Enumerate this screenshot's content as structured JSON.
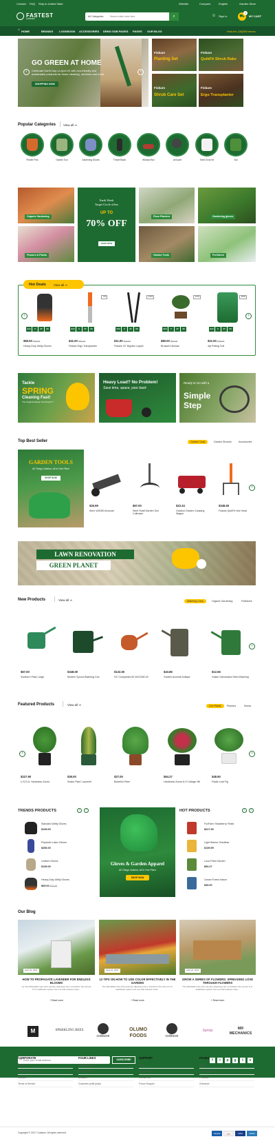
{
  "topbar": {
    "contact": "Contact",
    "faq": "FAQ",
    "ship": "Ship to United State",
    "wishlist": "Wishlist",
    "compare": "Compare",
    "language": "English",
    "store": "Garden Store"
  },
  "header": {
    "logo": "FASTEST",
    "logo_sub": "GARDEN",
    "category_select": "All Categories",
    "search_placeholder": "Search entire store here",
    "signin": "Sign In",
    "cart_count": "0",
    "cart_label": "MY CART"
  },
  "nav": {
    "items": [
      "HOME",
      "BRANDS",
      "LOOKBOOK",
      "ACCESSORIES",
      "DEMO SUB PAGES",
      "PAGES",
      "OUR BLOG"
    ],
    "hotline": "HotLine: (36)359 shoes"
  },
  "hero": {
    "title": "GO GREEN AT HOME",
    "text": "Celebrate Earth Day on April 22 with eco-friendly and sustainable products for home cleaning, outdoors and more.",
    "button": "SHOPPING NOW"
  },
  "hero_tiles": [
    {
      "brand": "Fiskars",
      "label": "Planting Set"
    },
    {
      "brand": "Fiskars",
      "label": "QuikFit Shrub Rake"
    },
    {
      "brand": "Fiskars",
      "label": "Shrub Care Set"
    },
    {
      "brand": "Fiskars",
      "label": "Ergo Transplanter"
    }
  ],
  "popular": {
    "title": "Popular Categories",
    "view_all": "View all",
    "items": [
      "Planter Pots",
      "Garden Tool",
      "Gardening Gloves",
      "Trowel Black",
      "Window Box",
      "Aerocart",
      "Seed Grow Kit",
      "Soil"
    ]
  },
  "promo": {
    "tiles": [
      "Organic Gardening",
      "Flowers & Plants",
      "Floor Planters",
      "Gardening gloves",
      "Garden Tools",
      "Fertilizers"
    ],
    "center_line1": "Earth Week",
    "center_line2": "Target Circle offers",
    "center_upto": "UP TO",
    "center_off": "70% OFF",
    "center_btn": "SHOP NOW"
  },
  "hot_deals": {
    "title": "Hot Deals",
    "view_all": "View all",
    "countdown": {
      "labels": [
        "Days",
        "Hours",
        "Mins",
        "Secs"
      ]
    },
    "items": [
      {
        "price": "$65.00",
        "old": "$75.00",
        "name": "Heavy-Duty Utility Gloves",
        "cd": [
          "910",
          "5",
          "37",
          "20"
        ]
      },
      {
        "price": "$41.00",
        "old": "$50.00",
        "name": "Fiskars Ergo Transplanter",
        "cd": [
          "910",
          "5",
          "37",
          "20"
        ],
        "badge": "-7%"
      },
      {
        "price": "$11.00",
        "old": "$19.00",
        "name": "Fiskars 24\" Bypass Lopper",
        "cd": [
          "240",
          "5",
          "37",
          "20"
        ],
        "badge": "-12%"
      },
      {
        "price": "$80.00",
        "old": "$92.00",
        "name": "Brussel's Bonsai",
        "cd": [
          "912",
          "5",
          "37",
          "20"
        ],
        "badge": "-12%"
      },
      {
        "price": "$21.00",
        "old": "$29.00",
        "name": "4qt Potting Soil",
        "cd": [
          "910",
          "5",
          "37",
          "20"
        ],
        "badge": "-20%"
      }
    ]
  },
  "banners3": [
    {
      "line1": "Tackle",
      "line2": "SPRING",
      "line3": "Cleaning Fast!",
      "line4": "The Original Garden Tool Scoop™"
    },
    {
      "line1": "Heavy Load? No Problem!",
      "line2": "Save time, space, your back"
    },
    {
      "line1": "Ready to Go with a",
      "line2": "Simple",
      "line3": "Step"
    }
  ],
  "best_seller": {
    "title": "Top Best Seller",
    "tabs": [
      "Garden Tools",
      "Garden Shovels",
      "Accessories"
    ],
    "banner_title": "GARDEN TOOLS",
    "banner_sub": "All Things Outdoor, All In One Place",
    "banner_btn": "SHOP NOW",
    "items": [
      {
        "price": "$25.99",
        "name": "Worx WG050 Aerocart"
      },
      {
        "price": "$67.00",
        "name": "Steel Shaft Garden Soil Cultivator"
      },
      {
        "price": "$23.34",
        "name": "Outdoor Garden Camping Wagon"
      },
      {
        "price": "$348.50",
        "name": "Fiskars QuikFit Hoe Head"
      }
    ]
  },
  "lawn": {
    "line1": "LAWN RENOVATION",
    "line2": "GREEN PLANET"
  },
  "new_products": {
    "title": "New Products",
    "view_all": "View all",
    "tabs": [
      "Watering Cans",
      "Organic Gardening",
      "Fertilizers"
    ],
    "items": [
      {
        "price": "$67.00",
        "name": "Southern Patio Large"
      },
      {
        "price": "$348.00",
        "name": "Modern Sprout Watering Can"
      },
      {
        "price": "$132.00",
        "name": "HC Companies 82 WC2G8C20"
      },
      {
        "price": "$43.86",
        "name": "Garden Accents Antique"
      },
      {
        "price": "$12.56",
        "name": "Gallon Galvanized Steel Watering"
      }
    ]
  },
  "featured": {
    "title": "Featured Products",
    "view_all": "View all",
    "tabs": [
      "Live Plants",
      "Planters",
      "Seeds"
    ],
    "items": [
      {
        "price": "$227.90",
        "name": "U.S.D.A. Hardiness Zones"
      },
      {
        "price": "$35.00",
        "name": "Snake Plant 'Laurentii'"
      },
      {
        "price": "$27.00",
        "name": "Bobellini Palm"
      },
      {
        "price": "$64.27",
        "name": "Hardiness Zones 6-9 Cottage Hill"
      },
      {
        "price": "$48.90",
        "name": "Fiddle Leaf Fig"
      }
    ]
  },
  "trends": {
    "title": "TRENDS PRODUCTS",
    "items": [
      {
        "name": "Standard Utility Gloves",
        "price": "$139.00"
      },
      {
        "name": "Polyester Latex Gloves",
        "price": "$256.00"
      },
      {
        "name": "Leather Gloves",
        "price": "$139.00"
      },
      {
        "name": "Heavy-Duty Utility Gloves",
        "price": "$65.00",
        "old": "$77.00"
      }
    ]
  },
  "gloves_banner": {
    "title": "Gloves & Garden Apparel",
    "sub": "All Things Outdoor, All In One Place",
    "btn": "SHOP NOW"
  },
  "hot_products": {
    "title": "HOT PRODUCTS",
    "items": [
      {
        "name": "FoxFarm Strawberry Fields",
        "price": "$227.90"
      },
      {
        "name": "Light Warrior Seedless",
        "price": "$139.99"
      },
      {
        "name": "Lucci Plant Garden",
        "price": "$54.27"
      },
      {
        "name": "Ocean Forest Indoor",
        "price": "$35.00"
      }
    ]
  },
  "blog": {
    "title": "Our Blog",
    "posts": [
      {
        "date": "April 22, 2021",
        "title": "HOW TO PROPAGATE LAVENDER FOR ENDLESS BLOOMS",
        "text": "Ivy The Affordable Care Act's primary objectives are to transform the current U.S. healthcare system into one that reduces costs...",
        "more": "+ Read more"
      },
      {
        "date": "April 22, 2021",
        "title": "12 TIPS ON HOW TO USE COLOR EFFECTIVELY IN THE GARDEN",
        "text": "The Affordable Care Act's primary objectives are to transform the current U.S. healthcare system into one that reduces costs...",
        "more": "+ Read more"
      },
      {
        "date": "April 22, 2021",
        "title": "GROW A SERIES OF FLOWERS: SPREADING LOVE THROUGH FLOWERS",
        "text": "The Affordable Care Act's primary objectives are to transform the current U.S. healthcare system into one that reduces costs...",
        "more": "+ Read more"
      }
    ]
  },
  "brands": [
    "M",
    "SPARKLING BEES",
    "codozon",
    "OLUMO FOODS",
    "codozon",
    "Sarita",
    "MR MECHANICS"
  ],
  "newsletter": {
    "placeholder": "Enter your email address",
    "button": "SUBSCRIBE"
  },
  "footer": {
    "cols": [
      {
        "title": "CORPORATE",
        "items": [
          "About Us",
          "Orders and Returns",
          "Wishlist",
          "Terms of Service"
        ]
      },
      {
        "title": "FOUR LINKS",
        "items": [
          "Shipping guide",
          "Store location",
          "Affiliates",
          "Customer profit policy"
        ]
      },
      {
        "title": "SUPPORT",
        "items": [
          "FAQ",
          "Our services",
          "Contact Us",
          "Forum Support"
        ]
      },
      {
        "title": "PAGES",
        "items": [
          "Home",
          "Our Categories",
          "Products",
          "Checkout"
        ]
      }
    ],
    "copyright": "Copyright © 2017 Codazon. All rights reserved.",
    "payments": [
      "PayPal",
      "MC",
      "VISA",
      "AMEX"
    ]
  },
  "colors": {
    "brand_green": "#1e6b31",
    "accent_yellow": "#fdc500"
  }
}
